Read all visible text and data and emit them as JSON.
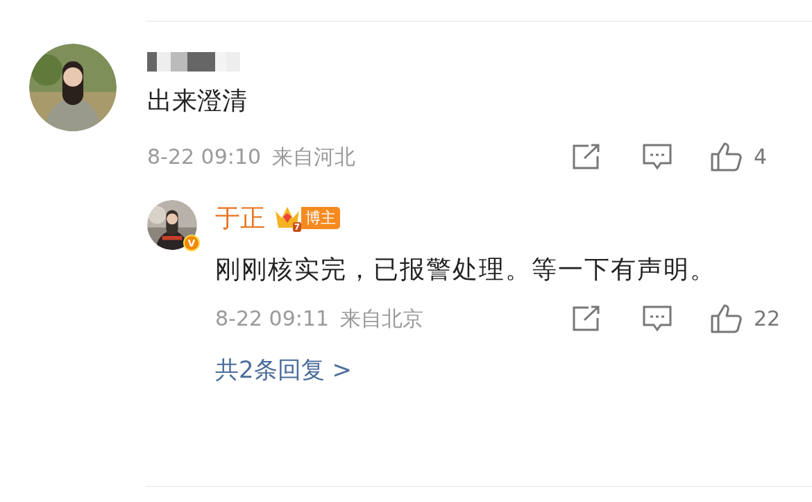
{
  "comment": {
    "text": "出来澄清",
    "time": "8-22 09:10",
    "location": "来自河北",
    "likes": "4"
  },
  "reply": {
    "name": "于正",
    "verified_mark": "V",
    "rank": "7",
    "badge": "博主",
    "text": "刚刚核实完，已报警处理。等一下有声明。",
    "time": "8-22 09:11",
    "location": "来自北京",
    "likes": "22"
  },
  "more_replies": "共2条回复 >"
}
